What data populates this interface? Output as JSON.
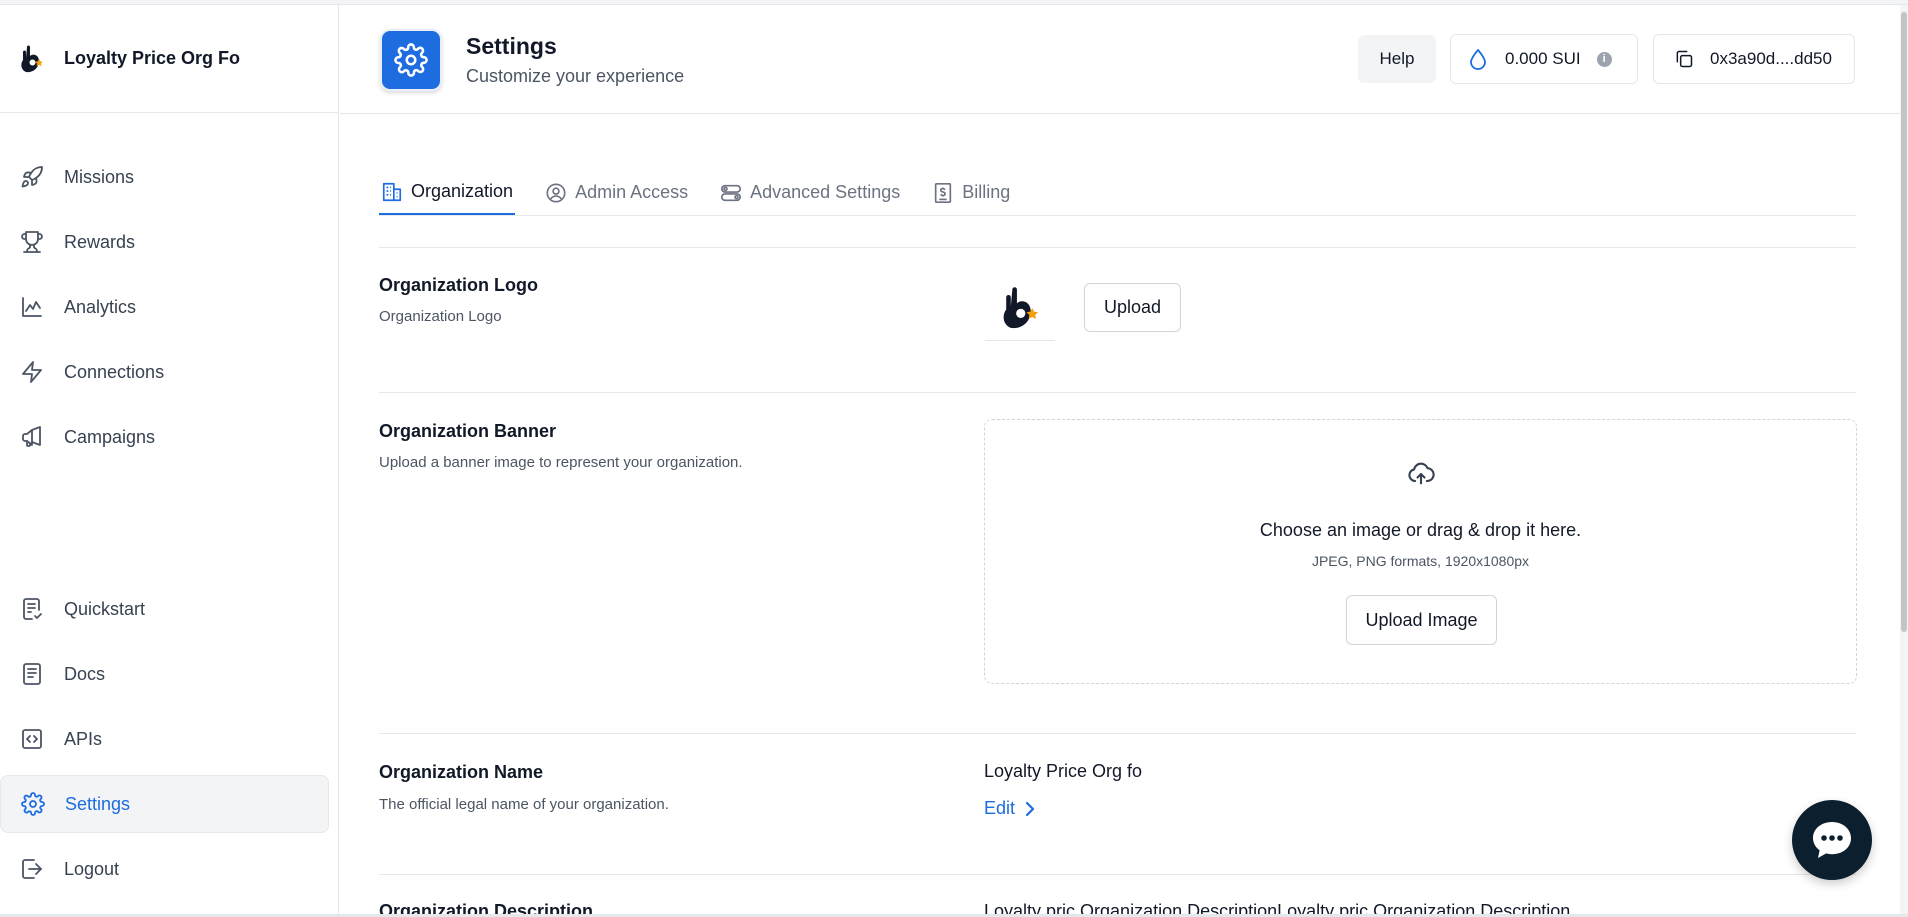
{
  "brand": {
    "name": "Loyalty Price Org Fo",
    "logo_icon": "ok-hand-logo"
  },
  "sidebar": {
    "top_items": [
      {
        "label": "Missions",
        "icon": "rocket-icon"
      },
      {
        "label": "Rewards",
        "icon": "trophy-icon"
      },
      {
        "label": "Analytics",
        "icon": "chart-line-icon"
      },
      {
        "label": "Connections",
        "icon": "lightning-icon"
      },
      {
        "label": "Campaigns",
        "icon": "megaphone-icon"
      }
    ],
    "bottom_items": [
      {
        "label": "Quickstart",
        "icon": "checklist-icon"
      },
      {
        "label": "Docs",
        "icon": "document-icon"
      },
      {
        "label": "APIs",
        "icon": "code-icon"
      },
      {
        "label": "Settings",
        "icon": "gear-icon",
        "active": true
      },
      {
        "label": "Logout",
        "icon": "logout-icon"
      }
    ]
  },
  "header": {
    "title": "Settings",
    "subtitle": "Customize your experience",
    "help_label": "Help",
    "balance": "0.000 SUI",
    "info_glyph": "i",
    "wallet": "0x3a90d....dd50"
  },
  "tabs": [
    {
      "label": "Organization",
      "icon": "building-icon",
      "active": true
    },
    {
      "label": "Admin Access",
      "icon": "user-circle-icon"
    },
    {
      "label": "Advanced Settings",
      "icon": "toggles-icon"
    },
    {
      "label": "Billing",
      "icon": "receipt-icon"
    }
  ],
  "org_logo": {
    "title": "Organization Logo",
    "description": "Organization Logo",
    "upload_label": "Upload"
  },
  "org_banner": {
    "title": "Organization Banner",
    "description": "Upload a banner image to represent your organization.",
    "dropzone_title": "Choose an image or drag & drop it here.",
    "dropzone_sub": "JPEG, PNG formats, 1920x1080px",
    "upload_label": "Upload Image"
  },
  "org_name": {
    "title": "Organization Name",
    "description": "The official legal name of your organization.",
    "value": "Loyalty Price Org fo",
    "edit_label": "Edit"
  },
  "org_description": {
    "title": "Organization Description",
    "value": "Loyalty pric Organization DescriptionLoyalty pric Organization Description"
  },
  "colors": {
    "accent": "#1d6ce0",
    "chat": "#0b1f2e"
  }
}
